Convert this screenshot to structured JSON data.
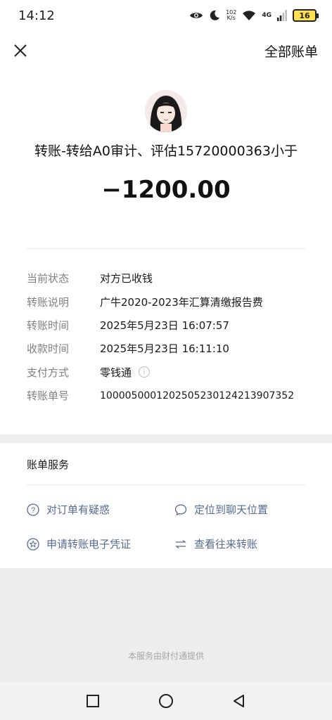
{
  "status_bar": {
    "time": "14:12",
    "net_speed": "102",
    "net_unit": "K/s",
    "signal": "4G",
    "battery": "16"
  },
  "nav": {
    "right_label": "全部账单",
    "close_icon": "close-icon"
  },
  "transfer": {
    "title": "转账-转给A0审计、评估15720000363小于",
    "amount": "−1200.00"
  },
  "details": [
    {
      "key": "当前状态",
      "value": "对方已收钱"
    },
    {
      "key": "转账说明",
      "value": "广牛2020-2023年汇算清缴报告费"
    },
    {
      "key": "转账时间",
      "value": "2025年5月23日 16:07:57"
    },
    {
      "key": "收款时间",
      "value": "2025年5月23日 16:11:10"
    },
    {
      "key": "支付方式",
      "value": "零钱通"
    },
    {
      "key": "转账单号",
      "value": "100005000120250523012421390735​2"
    }
  ],
  "services": {
    "heading": "账单服务",
    "items": [
      {
        "label": "对订单有疑惑",
        "icon": "question-circle-icon"
      },
      {
        "label": "定位到聊天位置",
        "icon": "chat-bubble-icon"
      },
      {
        "label": "申请转账电子凭证",
        "icon": "star-circle-icon"
      },
      {
        "label": "查看往来转账",
        "icon": "exchange-icon"
      }
    ]
  },
  "footer": "本服务由财付通提供"
}
